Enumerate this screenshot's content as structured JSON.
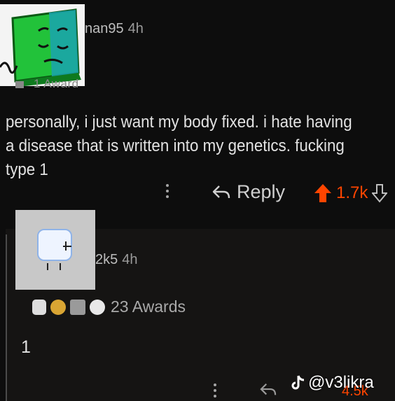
{
  "comment": {
    "username_visible": "nan95",
    "time": "4h",
    "awards_label": "1 Award",
    "text": "personally, i just want my body fixed. i hate having a disease that is written into my genetics. fucking type 1",
    "actions": {
      "reply_label": "Reply",
      "upvote_count": "1.7k"
    }
  },
  "reply": {
    "username_visible": "2k5",
    "time": "4h",
    "awards_label": "23 Awards",
    "text": "1",
    "upvote_count_partial": "4.5k"
  },
  "watermark": {
    "handle": "@v3likra",
    "icon": "tiktok-icon"
  },
  "colors": {
    "background": "#0d0d0d",
    "upvote": "#ff4500",
    "text": "#e2e2e2",
    "muted": "#9a9a9a"
  }
}
